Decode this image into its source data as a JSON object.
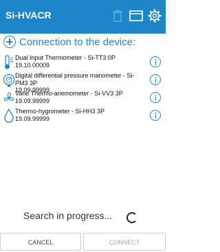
{
  "app": {
    "title": "Si-HVACR",
    "accent": "#1c86c8"
  },
  "appbar": {
    "icons": [
      "trash-icon",
      "window-icon",
      "gear-icon"
    ]
  },
  "connection": {
    "title": "Connection to the device:"
  },
  "devices": [
    {
      "name": "Dual Input Thermometer - Si-TT3 0P",
      "version": "19.10.00009",
      "icon": "thermometer-icon"
    },
    {
      "name": "Digital differential pressure manometer - Si-PM3 3P",
      "version": "19.09.99999",
      "icon": "manometer-icon"
    },
    {
      "name": "Vane Thermo-anemometer - Si-VV3 3P",
      "version": "19.09.99999",
      "icon": "fan-icon"
    },
    {
      "name": "Thermo-hygrometer - Si-HH3 3P",
      "version": "19.09.99999",
      "icon": "drop-icon"
    }
  ],
  "status": {
    "search_text": "Search in progress..."
  },
  "buttons": {
    "cancel": "CANCEL",
    "connect": "CONNECT"
  }
}
